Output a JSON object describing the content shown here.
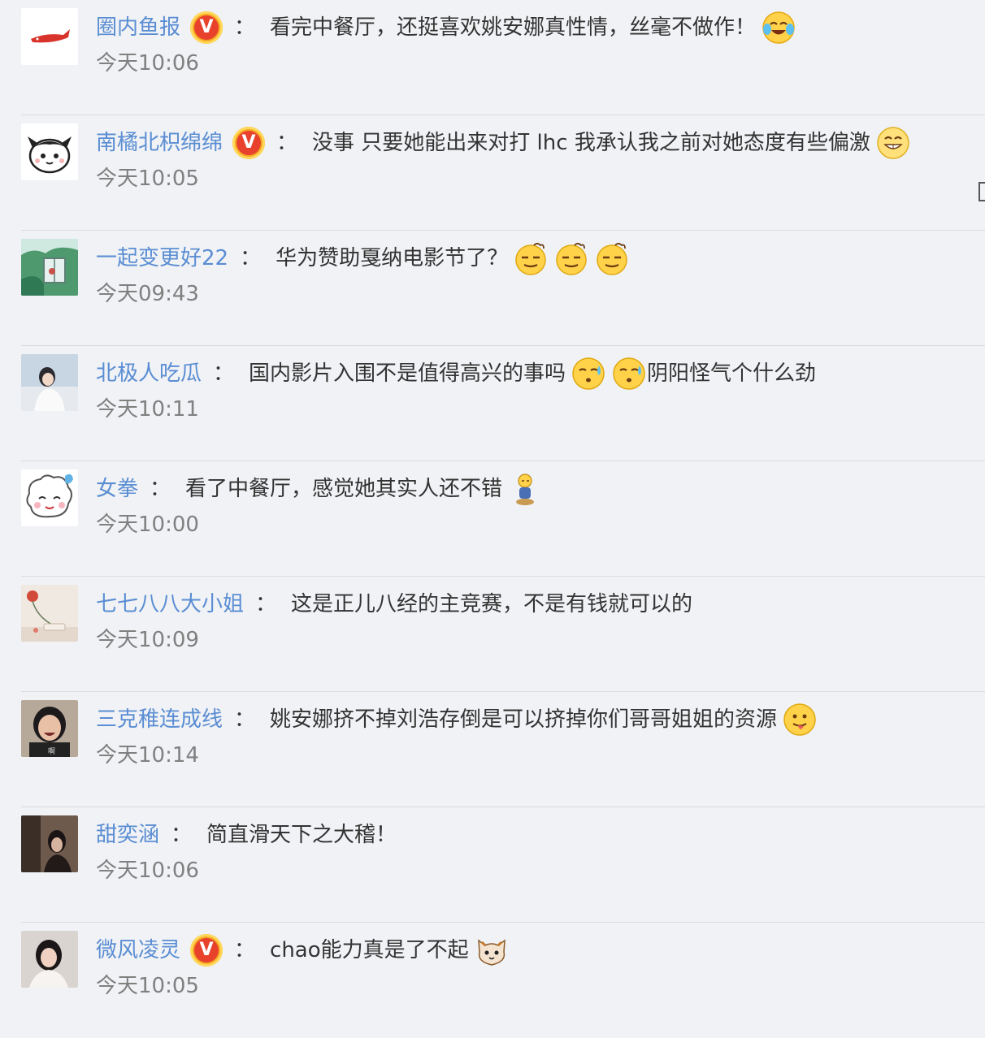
{
  "comments": [
    {
      "user": "圈内鱼报",
      "verified": true,
      "parts": [
        {
          "t": "看完中餐厅，还挺喜欢姚安娜真性情，丝毫不做作！"
        },
        {
          "e": "laugh-cry"
        }
      ],
      "time": "今天10:06",
      "avatar": "whale"
    },
    {
      "user": "南橘北枳绵绵",
      "verified": true,
      "parts": [
        {
          "t": "没事 只要她能出来对打 lhc 我承认我之前对她态度有些偏激"
        },
        {
          "e": "grin"
        }
      ],
      "time": "今天10:05",
      "avatar": "cartoon-bun"
    },
    {
      "user": "一起变更好22",
      "verified": false,
      "parts": [
        {
          "t": "华为赞助戛纳电影节了？"
        },
        {
          "e": "smug"
        },
        {
          "e": "smug"
        },
        {
          "e": "smug"
        }
      ],
      "time": "今天09:43",
      "avatar": "window-scene"
    },
    {
      "user": "北极人吃瓜",
      "verified": false,
      "parts": [
        {
          "t": "国内影片入围不是值得高兴的事吗"
        },
        {
          "e": "sweat"
        },
        {
          "e": "sweat"
        },
        {
          "t": " 阴阳怪气个什么劲"
        }
      ],
      "time": "今天10:11",
      "avatar": "girl-photo"
    },
    {
      "user": "女拳",
      "verified": false,
      "parts": [
        {
          "t": "看了中餐厅，感觉她其实人还不错"
        },
        {
          "e": "figure"
        }
      ],
      "time": "今天10:00",
      "avatar": "cartoon-sheep"
    },
    {
      "user": "七七八八大小姐",
      "verified": false,
      "parts": [
        {
          "t": "这是正儿八经的主竞赛，不是有钱就可以的"
        }
      ],
      "time": "今天10:09",
      "avatar": "flowers"
    },
    {
      "user": "三克稚连成线",
      "verified": false,
      "parts": [
        {
          "t": "姚安娜挤不掉刘浩存倒是可以挤掉你们哥哥姐姐的资源"
        },
        {
          "e": "tongue"
        }
      ],
      "time": "今天10:14",
      "avatar": "laughing-girl"
    },
    {
      "user": "甜奕涵",
      "verified": false,
      "parts": [
        {
          "t": "简直滑天下之大稽！"
        }
      ],
      "time": "今天10:06",
      "avatar": "dark-room"
    },
    {
      "user": "微风凌灵",
      "verified": true,
      "parts": [
        {
          "t": "chao能力真是了不起"
        },
        {
          "e": "cat"
        }
      ],
      "time": "今天10:05",
      "avatar": "woman-photo"
    }
  ],
  "separator": "：",
  "verified_badge": "V",
  "colors": {
    "username": "#5a8dd3",
    "text": "#333333",
    "time": "#808080",
    "background": "#f0f2f5",
    "divider": "#d9dce0"
  }
}
